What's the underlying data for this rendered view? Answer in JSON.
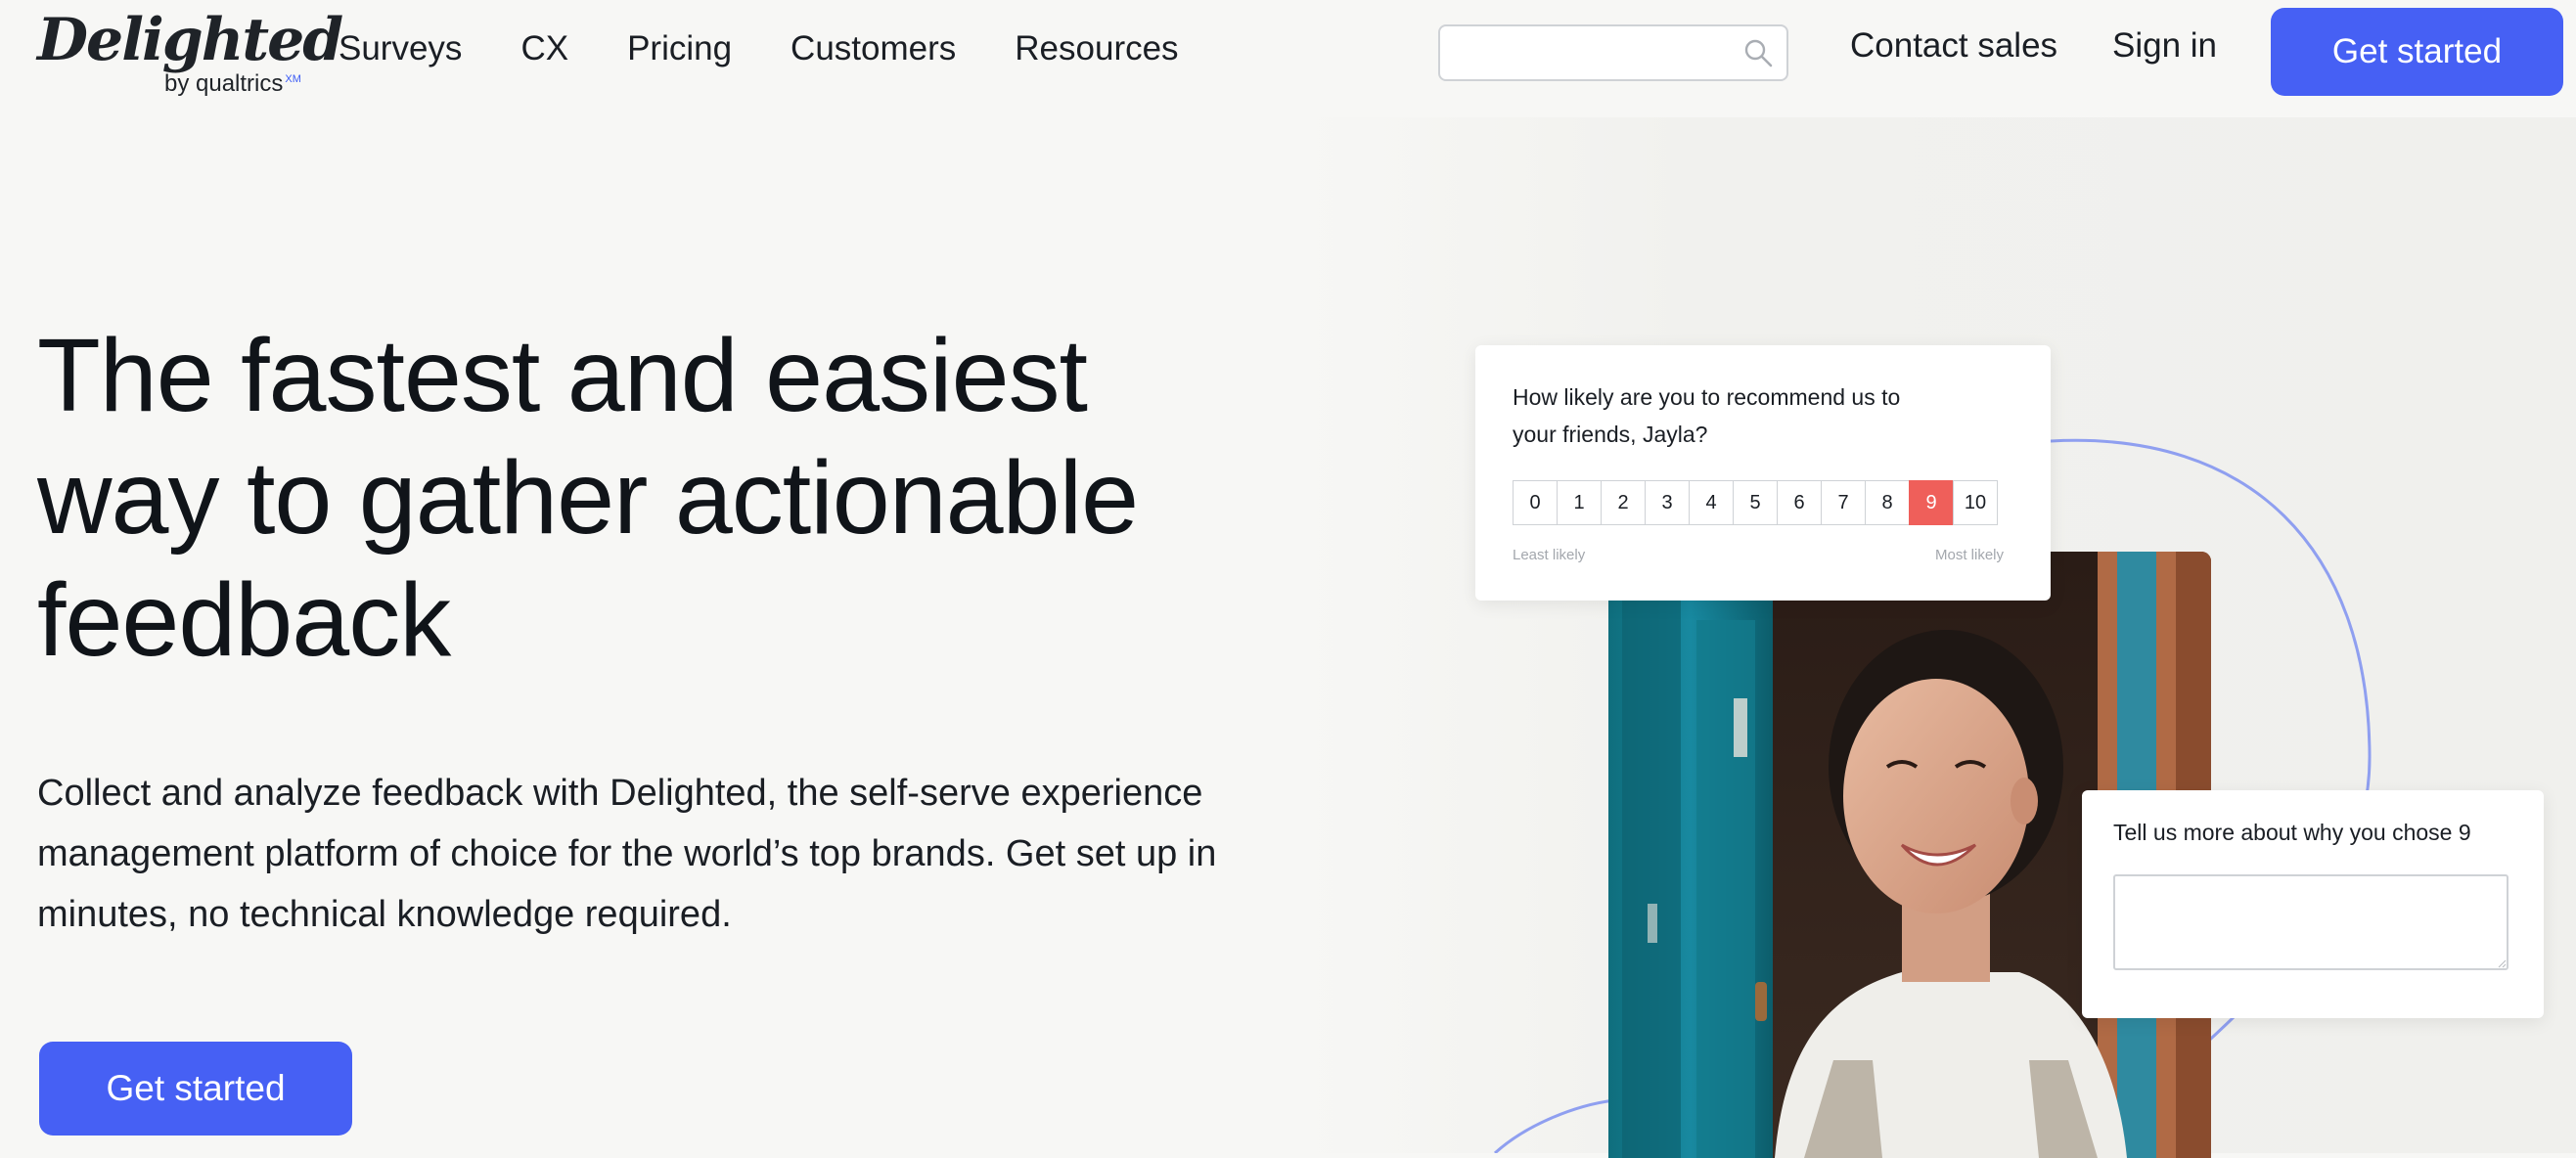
{
  "header": {
    "logo_text": "Delighted",
    "logo_sub": "by qualtrics",
    "logo_sup": "XM",
    "nav": [
      "Surveys",
      "CX",
      "Pricing",
      "Customers",
      "Resources"
    ],
    "search_placeholder": "",
    "contact_label": "Contact sales",
    "signin_label": "Sign in",
    "cta_label": "Get started"
  },
  "hero": {
    "title": "The fastest and easiest way to gather actionable feedback",
    "description": "Collect and analyze feedback with Delighted, the self-serve experience management platform of choice for the world’s top brands. Get set up in minutes, no technical knowledge required.",
    "cta_label": "Get started"
  },
  "nps_card": {
    "question": "How likely are you to recommend us to your friends, Jayla?",
    "scale": [
      "0",
      "1",
      "2",
      "3",
      "4",
      "5",
      "6",
      "7",
      "8",
      "9",
      "10"
    ],
    "selected": "9",
    "least_label": "Least likely",
    "most_label": "Most likely"
  },
  "followup_card": {
    "question": "Tell us more about why you chose 9",
    "value": ""
  },
  "colors": {
    "accent": "#4660f4",
    "selected_score": "#ef5f5a",
    "background": "#f7f7f5",
    "deco_line": "#8f9ff0"
  },
  "icons": {
    "search": "search-icon"
  }
}
